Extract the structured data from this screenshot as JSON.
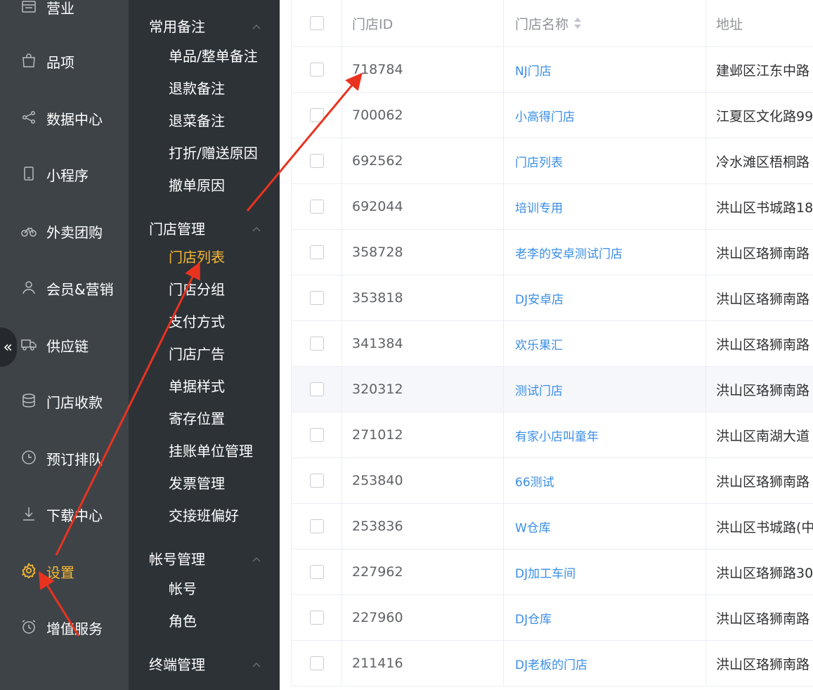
{
  "nav": {
    "items": [
      {
        "label": "营业",
        "icon": "calendar-icon"
      },
      {
        "label": "品项",
        "icon": "shopping-bag-icon"
      },
      {
        "label": "数据中心",
        "icon": "share-icon"
      },
      {
        "label": "小程序",
        "icon": "mobile-icon"
      },
      {
        "label": "外卖团购",
        "icon": "bicycle-icon"
      },
      {
        "label": "会员&营销",
        "icon": "user-icon"
      },
      {
        "label": "供应链",
        "icon": "truck-icon"
      },
      {
        "label": "门店收款",
        "icon": "database-icon"
      },
      {
        "label": "预订排队",
        "icon": "clock-icon"
      },
      {
        "label": "下载中心",
        "icon": "download-icon"
      },
      {
        "label": "设置",
        "icon": "gear-icon"
      },
      {
        "label": "增值服务",
        "icon": "alarm-clock-icon"
      }
    ],
    "active": "设置",
    "collapse_glyph": "«"
  },
  "subnav": {
    "groups": [
      {
        "label": "常用备注",
        "items": [
          "单品/整单备注",
          "退款备注",
          "退菜备注",
          "打折/赠送原因",
          "撤单原因"
        ]
      },
      {
        "label": "门店管理",
        "items": [
          "门店列表",
          "门店分组",
          "支付方式",
          "门店广告",
          "单据样式",
          "寄存位置",
          "挂账单位管理",
          "发票管理",
          "交接班偏好"
        ]
      },
      {
        "label": "帐号管理",
        "items": [
          "帐号",
          "角色"
        ]
      },
      {
        "label": "终端管理",
        "items": []
      }
    ],
    "active": "门店列表"
  },
  "table": {
    "columns": [
      "门店ID",
      "门店名称",
      "地址"
    ],
    "rows": [
      {
        "id": "718784",
        "name": "NJ门店",
        "address": "建邺区江东中路"
      },
      {
        "id": "700062",
        "name": "小高得门店",
        "address": "江夏区文化路99"
      },
      {
        "id": "692562",
        "name": "门店列表",
        "address": "冷水滩区梧桐路"
      },
      {
        "id": "692044",
        "name": "培训专用",
        "address": "洪山区书城路18"
      },
      {
        "id": "358728",
        "name": "老李的安卓测试门店",
        "address": "洪山区珞狮南路"
      },
      {
        "id": "353818",
        "name": "DJ安卓店",
        "address": "洪山区珞狮南路"
      },
      {
        "id": "341384",
        "name": "欢乐果汇",
        "address": "洪山区珞狮南路"
      },
      {
        "id": "320312",
        "name": "测试门店",
        "address": "洪山区珞狮南路"
      },
      {
        "id": "271012",
        "name": "有家小店叫童年",
        "address": "洪山区南湖大道"
      },
      {
        "id": "253840",
        "name": "66测试",
        "address": "洪山区珞狮南路"
      },
      {
        "id": "253836",
        "name": "W仓库",
        "address": "洪山区书城路(中"
      },
      {
        "id": "227962",
        "name": "DJ加工车间",
        "address": "洪山区珞狮路30"
      },
      {
        "id": "227960",
        "name": "DJ仓库",
        "address": "洪山区珞狮南路"
      },
      {
        "id": "211416",
        "name": "DJ老板的门店",
        "address": "洪山区珞狮南路"
      }
    ],
    "highlighted_row": 7
  },
  "colors": {
    "accent": "#f5b731",
    "link": "#3a8ee6",
    "arrow": "#e8331f"
  }
}
